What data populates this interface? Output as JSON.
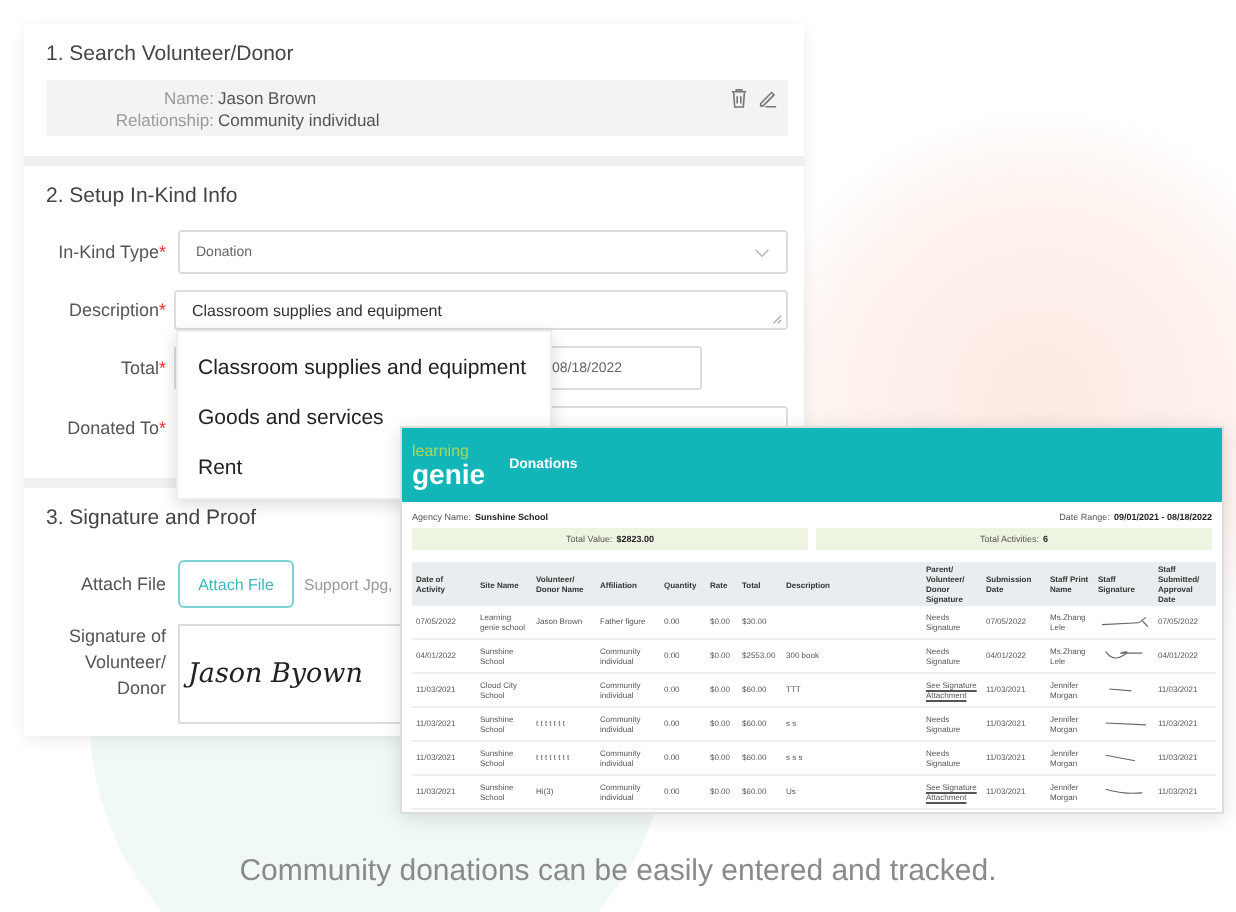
{
  "volunteer_section": {
    "title": "1. Search Volunteer/Donor",
    "fields": [
      {
        "label": "Name:",
        "value": "Jason Brown"
      },
      {
        "label": "Relationship:",
        "value": "Community individual"
      }
    ]
  },
  "inkind_section": {
    "title": "2. Setup In-Kind Info",
    "required_mark": "*",
    "type": {
      "label": "In-Kind Type",
      "required": true,
      "value": "Donation"
    },
    "description": {
      "label": "Description",
      "required": true,
      "value": "Classroom supplies and equipment"
    },
    "total": {
      "label": "Total",
      "required": true,
      "date": "08/18/2022"
    },
    "donated_to": {
      "label": "Donated To",
      "required": true
    }
  },
  "description_menu": [
    {
      "label": "Classroom supplies and equipment"
    },
    {
      "label": "Goods and services"
    },
    {
      "label": "Rent"
    }
  ],
  "signature_section": {
    "title": "3. Signature and Proof",
    "attach_label": "Attach File",
    "attach_button": "Attach File",
    "attach_hint": "Support Jpg,",
    "signature_label": "Signature of Volunteer/ Donor",
    "signature": "Jason Byown"
  },
  "report": {
    "logo_top": "learning",
    "logo_bottom": "genie",
    "title": "Donations",
    "agency_label": "Agency Name:",
    "agency": "Sunshine School",
    "range_label": "Date Range:",
    "range": "09/01/2021 - 08/18/2022",
    "total_value_label": "Total Value:",
    "total_value": "$2823.00",
    "total_activities_label": "Total Activities:",
    "total_activities": "6",
    "columns": [
      "Date of Activity",
      "Site Name",
      "Volunteer/ Donor Name",
      "Affiliation",
      "Quantity",
      "Rate",
      "Total",
      "Description",
      "Parent/ Volunteer/ Donor Signature",
      "Submission Date",
      "Staff Print Name",
      "Staff Signature",
      "Staff Submitted/ Approval Date"
    ],
    "rows": [
      {
        "date": "07/05/2022",
        "site": "Learning genie school",
        "donor": "Jason Brown",
        "affiliation": "Father figure",
        "quantity": "0.00",
        "rate": "$0.00",
        "total": "$30.00",
        "signature": {
          "kind": "needs",
          "text": "Needs Signature"
        },
        "submitted": "07/05/2022",
        "staff": "Ms.Zhang Lele",
        "approved": "07/05/2022"
      },
      {
        "date": "04/01/2022",
        "site": "Sunshine School",
        "affiliation": "Community individual",
        "quantity": "0.00",
        "rate": "$0.00",
        "total": "$2553.00",
        "description": "300 book",
        "signature": {
          "kind": "needs",
          "text": "Needs Signature"
        },
        "submitted": "04/01/2022",
        "staff": "Ms.Zhang Lele",
        "approved": "04/01/2022"
      },
      {
        "date": "11/03/2021",
        "site": "Cloud City School",
        "affiliation": "Community individual",
        "quantity": "0.00",
        "rate": "$0.00",
        "total": "$60.00",
        "description": "TTT",
        "signature": {
          "kind": "attachment",
          "text": "See Signature Attachment"
        },
        "submitted": "11/03/2021",
        "staff": "Jennifer Morgan",
        "approved": "11/03/2021"
      },
      {
        "date": "11/03/2021",
        "site": "Sunshine School",
        "donor": "t t t t t t t",
        "affiliation": "Community individual",
        "quantity": "0.00",
        "rate": "$0.00",
        "total": "$60.00",
        "description": "s s",
        "signature": {
          "kind": "needs",
          "text": "Needs Signature"
        },
        "submitted": "11/03/2021",
        "staff": "Jennifer Morgan",
        "approved": "11/03/2021"
      },
      {
        "date": "11/03/2021",
        "site": "Sunshine School",
        "donor": "t t t t t t t t",
        "affiliation": "Community individual",
        "quantity": "0.00",
        "rate": "$0.00",
        "total": "$60.00",
        "description": "s s s",
        "signature": {
          "kind": "needs",
          "text": "Needs Signature"
        },
        "submitted": "11/03/2021",
        "staff": "Jennifer Morgan",
        "approved": "11/03/2021"
      },
      {
        "date": "11/03/2021",
        "site": "Sunshine School",
        "donor": "Hi(3)",
        "affiliation": "Community individual",
        "quantity": "0.00",
        "rate": "$0.00",
        "total": "$60.00",
        "description": "Us",
        "signature": {
          "kind": "attachment",
          "text": "See Signature Attachment"
        },
        "submitted": "11/03/2021",
        "staff": "Jennifer Morgan",
        "approved": "11/03/2021"
      }
    ]
  },
  "caption": "Community donations can be easily entered and tracked."
}
